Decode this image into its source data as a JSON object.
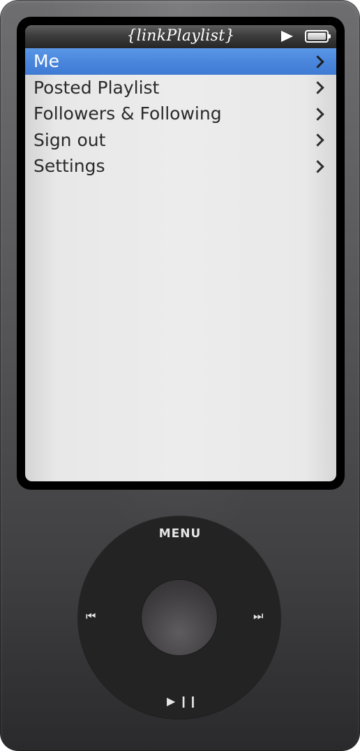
{
  "app": {
    "title": "{linkPlaylist}",
    "status_icons": [
      "play-icon",
      "battery-icon"
    ]
  },
  "menu": {
    "items": [
      {
        "label": "Me",
        "selected": true
      },
      {
        "label": "Posted Playlist",
        "selected": false
      },
      {
        "label": "Followers & Following",
        "selected": false
      },
      {
        "label": "Sign out",
        "selected": false
      },
      {
        "label": "Settings",
        "selected": false
      }
    ]
  },
  "wheel": {
    "menu_label": "MENU",
    "prev_glyph": "⏮",
    "next_glyph": "⏭",
    "playpause_glyph": "▶ ❙❙"
  },
  "colors": {
    "selection": "#4a86dc",
    "titlebar": "#3d3d3d",
    "screen_bg": "#ececec",
    "wheel": "#232323",
    "body": "#505052"
  }
}
